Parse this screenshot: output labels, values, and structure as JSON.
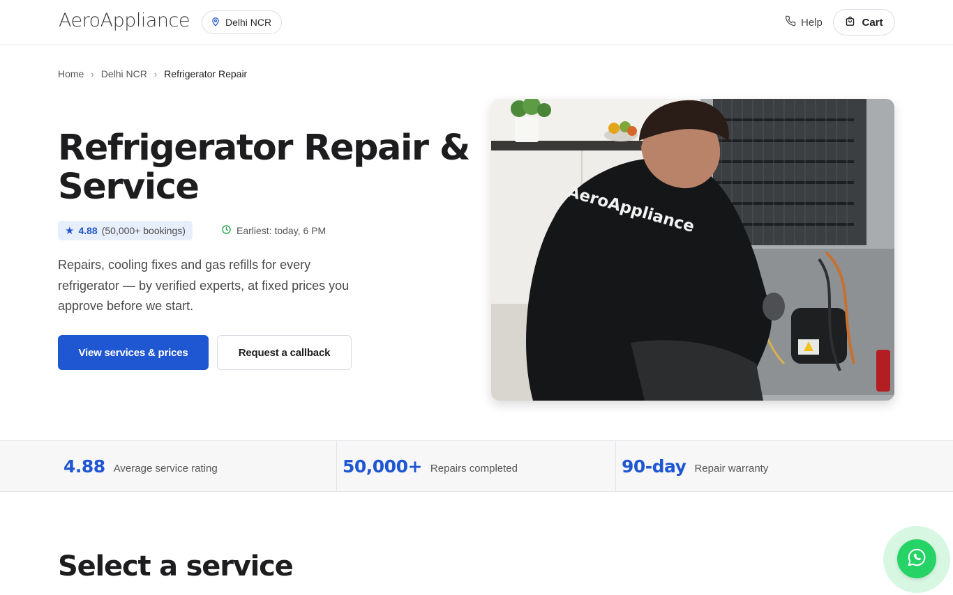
{
  "header": {
    "logo": "AeroAppliance",
    "location": "Delhi NCR",
    "help_label": "Help",
    "cart_label": "Cart"
  },
  "breadcrumb": [
    "Home",
    "Delhi NCR",
    "Refrigerator Repair"
  ],
  "hero": {
    "title_line1": "Refrigerator Repair &",
    "title_line2": "Service",
    "rating": "4.88",
    "bookings": "(50,000+ bookings)",
    "earliest": "Earliest: today, 6 PM",
    "description": "Repairs, cooling fixes and gas refills for every refrigerator — by verified experts, at fixed prices you approve before we start.",
    "primary_cta": "View services & prices",
    "secondary_cta": "Request a callback",
    "image_shirt_text": "AeroAppliance"
  },
  "stats": [
    {
      "value": "4.88",
      "label": "Average service rating"
    },
    {
      "value": "50,000+",
      "label": "Repairs completed"
    },
    {
      "value": "90-day",
      "label": "Repair warranty"
    }
  ],
  "section": {
    "title": "Select a service"
  },
  "colors": {
    "brand_blue": "#1f56d2",
    "whatsapp_green": "#25d366",
    "rating_chip_bg": "#e8effc",
    "clock_green": "#22a447"
  },
  "icons": {
    "location": "map-pin-icon",
    "help": "phone-icon",
    "cart": "shopping-bag-icon",
    "rating": "star-icon",
    "earliest": "clock-icon",
    "fab": "whatsapp-icon"
  }
}
